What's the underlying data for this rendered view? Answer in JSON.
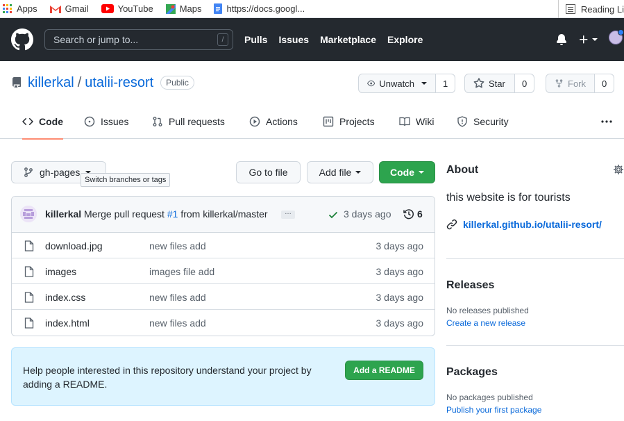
{
  "bookmarks": {
    "items": [
      {
        "label": "Apps"
      },
      {
        "label": "Gmail"
      },
      {
        "label": "YouTube"
      },
      {
        "label": "Maps"
      },
      {
        "label": "https://docs.googl..."
      }
    ],
    "reading_list": "Reading Li"
  },
  "header": {
    "search_placeholder": "Search or jump to...",
    "search_shortcut": "/",
    "nav": [
      "Pulls",
      "Issues",
      "Marketplace",
      "Explore"
    ]
  },
  "repo": {
    "owner": "killerkal",
    "separator": "/",
    "name": "utalii-resort",
    "visibility": "Public",
    "unwatch_label": "Unwatch",
    "watch_count": "1",
    "star_label": "Star",
    "star_count": "0",
    "fork_label": "Fork",
    "fork_count": "0"
  },
  "tabs": [
    {
      "label": "Code",
      "icon": "code-icon"
    },
    {
      "label": "Issues",
      "icon": "issue-icon"
    },
    {
      "label": "Pull requests",
      "icon": "pull-request-icon"
    },
    {
      "label": "Actions",
      "icon": "play-icon"
    },
    {
      "label": "Projects",
      "icon": "project-icon"
    },
    {
      "label": "Wiki",
      "icon": "book-icon"
    },
    {
      "label": "Security",
      "icon": "shield-icon"
    }
  ],
  "toolbar": {
    "branch": "gh-pages",
    "branch_tooltip": "Switch branches or tags",
    "go_to_file": "Go to file",
    "add_file": "Add file",
    "code": "Code"
  },
  "commit": {
    "author": "killerkal",
    "message_prefix": "Merge pull request",
    "pr_link": "#1",
    "message_suffix": "from killerkal/master",
    "ellipsis": "…",
    "time": "3 days ago",
    "history_count": "6"
  },
  "files": [
    {
      "name": "download.jpg",
      "message": "new files add",
      "age": "3 days ago",
      "type": "file"
    },
    {
      "name": "images",
      "message": "images file add",
      "age": "3 days ago",
      "type": "file"
    },
    {
      "name": "index.css",
      "message": "new files add",
      "age": "3 days ago",
      "type": "file"
    },
    {
      "name": "index.html",
      "message": "new files add",
      "age": "3 days ago",
      "type": "file"
    }
  ],
  "readme_prompt": {
    "text": "Help people interested in this repository understand your project by adding a README.",
    "button": "Add a README"
  },
  "sidebar": {
    "about_title": "About",
    "description": "this website is for tourists",
    "website": "killerkal.github.io/utalii-resort/",
    "releases_title": "Releases",
    "releases_empty": "No releases published",
    "releases_link": "Create a new release",
    "packages_title": "Packages",
    "packages_empty": "No packages published",
    "packages_link": "Publish your first package"
  },
  "colors": {
    "header_bg": "#24292f",
    "link": "#0969da",
    "primary_button": "#2da44e",
    "tab_underline": "#fd8c73",
    "readme_bg": "#ddf4ff"
  }
}
